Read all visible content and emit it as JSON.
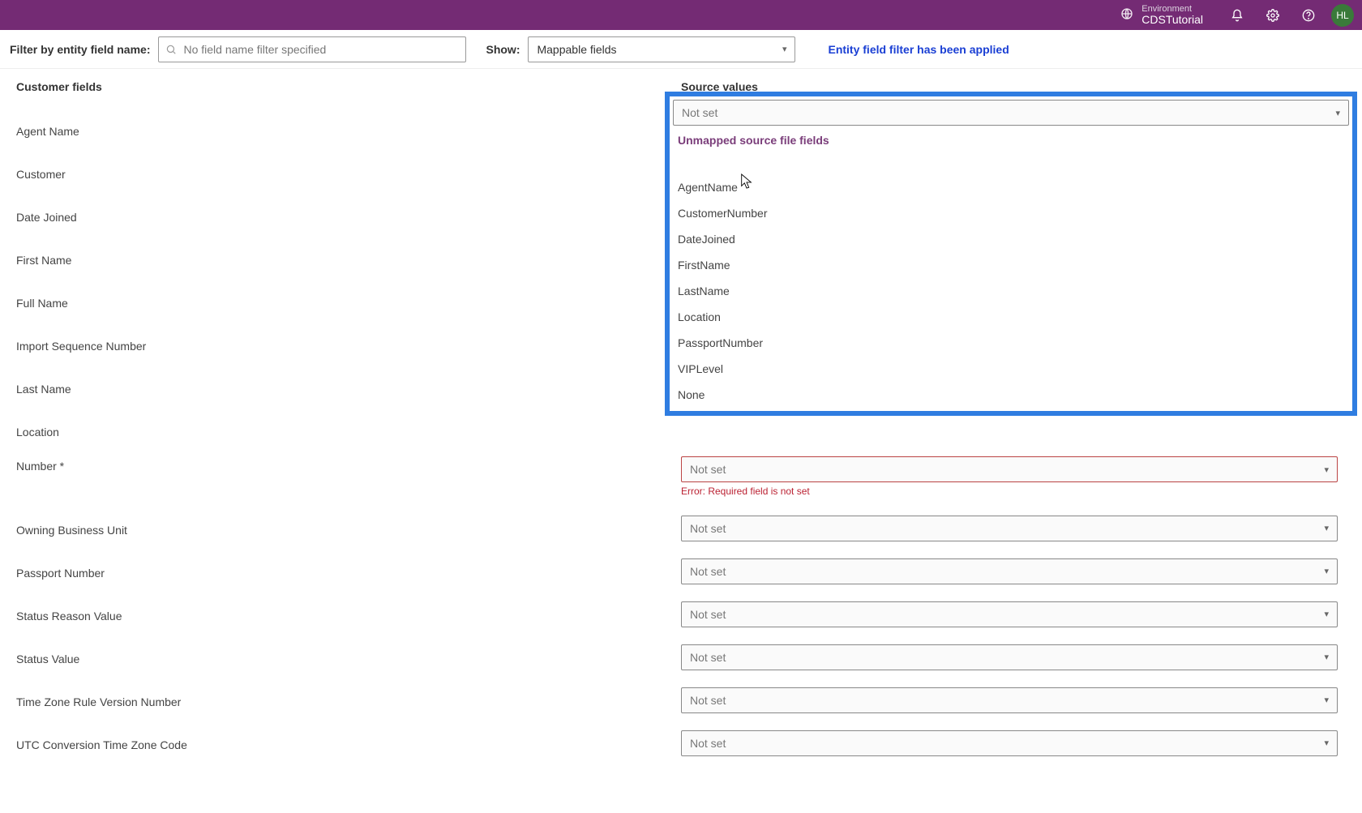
{
  "header": {
    "env_label": "Environment",
    "env_name": "CDSTutorial",
    "avatar_initials": "HL"
  },
  "filterbar": {
    "filter_label": "Filter by entity field name:",
    "filter_placeholder": "No field name filter specified",
    "show_label": "Show:",
    "show_value": "Mappable fields",
    "applied_msg": "Entity field filter has been applied"
  },
  "columns": {
    "left": "Customer fields",
    "right": "Source values"
  },
  "not_set": "Not set",
  "error_required": "Error: Required field is not set",
  "fields": {
    "f0": "Agent Name",
    "f1": "Customer",
    "f2": "Date Joined",
    "f3": "First Name",
    "f4": "Full Name",
    "f5": "Import Sequence Number",
    "f6": "Last Name",
    "f7": "Location",
    "f8": "Number *",
    "f9": "Owning Business Unit",
    "f10": "Passport Number",
    "f11": "Status Reason Value",
    "f12": "Status Value",
    "f13": "Time Zone Rule Version Number",
    "f14": "UTC Conversion Time Zone Code"
  },
  "dropdown": {
    "group_label": "Unmapped source file fields",
    "options": {
      "o0": "AgentName",
      "o1": "CustomerNumber",
      "o2": "DateJoined",
      "o3": "FirstName",
      "o4": "LastName",
      "o5": "Location",
      "o6": "PassportNumber",
      "o7": "VIPLevel",
      "o8": "None"
    }
  }
}
